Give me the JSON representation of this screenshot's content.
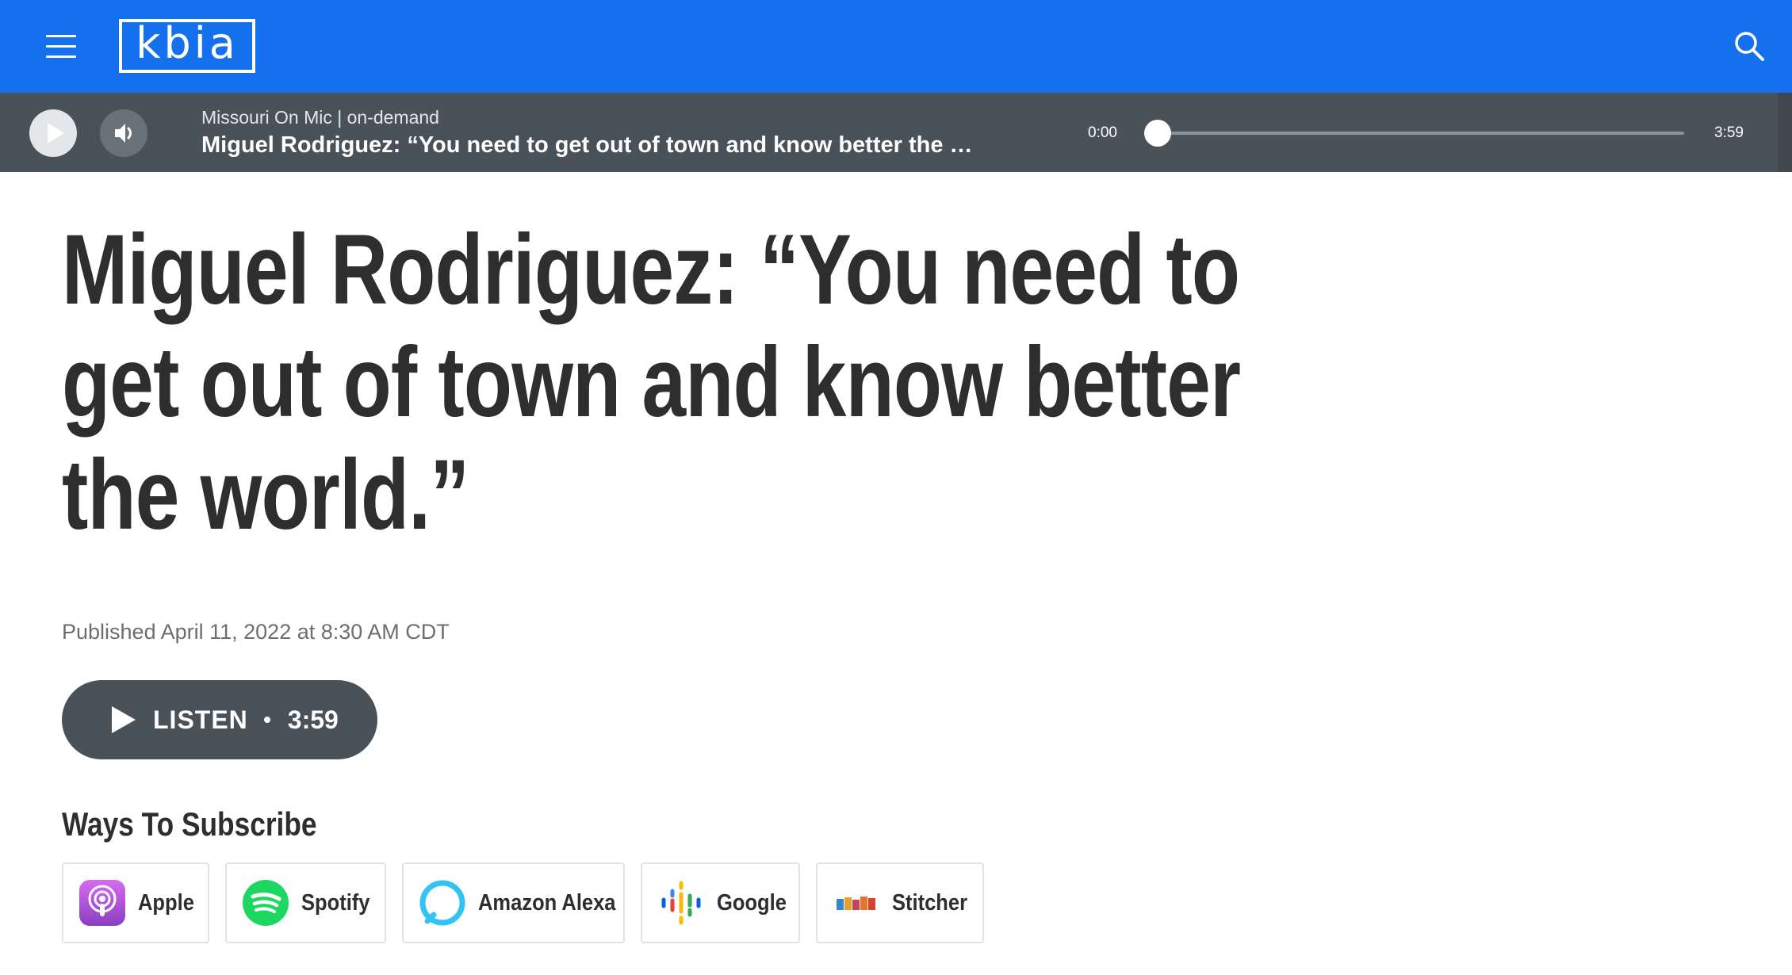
{
  "header": {
    "logo_text": "kbia",
    "brand_color": "#1470ec",
    "menu_icon": "hamburger-menu-icon",
    "search_icon": "search-icon"
  },
  "player": {
    "kicker": "Missouri On Mic | on-demand",
    "title": "Miguel Rodriguez: “You need to get out of town and know better the …",
    "current_time": "0:00",
    "total_time": "3:59",
    "progress_fraction": 0.0,
    "play_icon": "play-icon",
    "volume_icon": "volume-icon"
  },
  "article": {
    "headline": "Miguel Rodriguez: “You need to get out of town and know better the world.”",
    "published": "Published April 11, 2022 at 8:30 AM CDT",
    "listen_label": "LISTEN",
    "listen_duration": "3:59"
  },
  "subscribe": {
    "title": "Ways To Subscribe",
    "items": [
      {
        "label": "Apple",
        "icon": "apple-podcasts-icon"
      },
      {
        "label": "Spotify",
        "icon": "spotify-icon"
      },
      {
        "label": "Amazon Alexa",
        "icon": "amazon-alexa-icon"
      },
      {
        "label": "Google",
        "icon": "google-podcasts-icon"
      },
      {
        "label": "Stitcher",
        "icon": "stitcher-icon"
      }
    ]
  }
}
